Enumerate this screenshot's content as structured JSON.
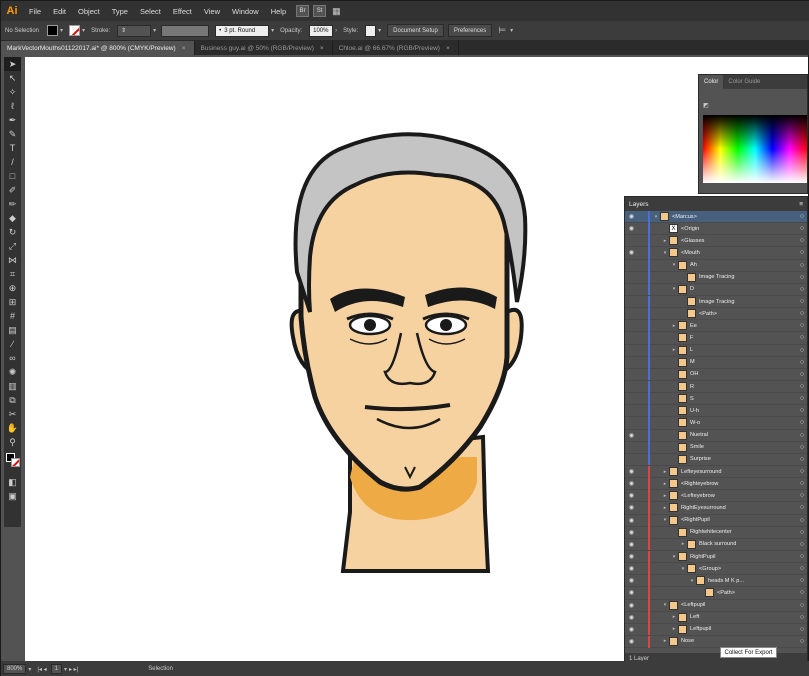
{
  "app": {
    "logo": "Ai"
  },
  "menu": [
    "File",
    "Edit",
    "Object",
    "Type",
    "Select",
    "Effect",
    "View",
    "Window",
    "Help"
  ],
  "menu_badges": [
    "Br",
    "St"
  ],
  "control": {
    "selection_label": "No Selection",
    "stroke_label": "Stroke:",
    "brush": "3 pt. Round",
    "opacity_label": "Opacity:",
    "opacity_value": "100%",
    "style_label": "Style:",
    "doc_setup": "Document Setup",
    "preferences": "Preferences"
  },
  "tabs": [
    {
      "label": "MarkVectorMouths01122017.ai* @ 800% (CMYK/Preview)"
    },
    {
      "label": "Business guy.ai @ 50% (RGB/Preview)"
    },
    {
      "label": "Chloe.ai @ 66.67% (RGB/Preview)"
    }
  ],
  "color_panel": {
    "tabs": [
      "Color",
      "Color Guide"
    ]
  },
  "layers_panel": {
    "title": "Layers",
    "footer": "1 Layer",
    "rows": [
      {
        "name": "<Marcus>",
        "indent": 0,
        "eye": true,
        "color": "#4a6fd8",
        "sel": true,
        "tw": "v"
      },
      {
        "name": "<Origin",
        "indent": 1,
        "eye": true,
        "color": "#4a6fd8",
        "tw": "",
        "thumb": "X"
      },
      {
        "name": "<Glasses",
        "indent": 1,
        "eye": false,
        "color": "#4a6fd8",
        "tw": ">"
      },
      {
        "name": "<Mouth",
        "indent": 1,
        "eye": true,
        "color": "#4a6fd8",
        "tw": "v"
      },
      {
        "name": "Ah",
        "indent": 2,
        "eye": false,
        "color": "#4a6fd8",
        "tw": "v"
      },
      {
        "name": "Image Tracing",
        "indent": 3,
        "eye": false,
        "color": "#4a6fd8",
        "tw": ""
      },
      {
        "name": "D",
        "indent": 2,
        "eye": false,
        "color": "#4a6fd8",
        "tw": "v"
      },
      {
        "name": "Image Tracing",
        "indent": 3,
        "eye": false,
        "color": "#4a6fd8",
        "tw": ""
      },
      {
        "name": "<Path>",
        "indent": 3,
        "eye": false,
        "color": "#4a6fd8",
        "tw": ""
      },
      {
        "name": "Ee",
        "indent": 2,
        "eye": false,
        "color": "#4a6fd8",
        "tw": ">"
      },
      {
        "name": "F",
        "indent": 2,
        "eye": false,
        "color": "#4a6fd8",
        "tw": ""
      },
      {
        "name": "L",
        "indent": 2,
        "eye": false,
        "color": "#4a6fd8",
        "tw": ">"
      },
      {
        "name": "M",
        "indent": 2,
        "eye": false,
        "color": "#4a6fd8",
        "tw": ""
      },
      {
        "name": "OH",
        "indent": 2,
        "eye": false,
        "color": "#4a6fd8",
        "tw": ""
      },
      {
        "name": "R",
        "indent": 2,
        "eye": false,
        "color": "#4a6fd8",
        "tw": ""
      },
      {
        "name": "S",
        "indent": 2,
        "eye": false,
        "color": "#4a6fd8",
        "tw": ""
      },
      {
        "name": "U-h",
        "indent": 2,
        "eye": false,
        "color": "#4a6fd8",
        "tw": ""
      },
      {
        "name": "W-o",
        "indent": 2,
        "eye": false,
        "color": "#4a6fd8",
        "tw": ""
      },
      {
        "name": "Nuetral",
        "indent": 2,
        "eye": true,
        "color": "#4a6fd8",
        "tw": ""
      },
      {
        "name": "Smile",
        "indent": 2,
        "eye": false,
        "color": "#4a6fd8",
        "tw": ""
      },
      {
        "name": "Surprise",
        "indent": 2,
        "eye": false,
        "color": "#4a6fd8",
        "tw": ""
      },
      {
        "name": "Lefteyesurround",
        "indent": 1,
        "eye": true,
        "color": "#d44",
        "tw": ">"
      },
      {
        "name": "<Righteyebrow",
        "indent": 1,
        "eye": true,
        "color": "#d44",
        "tw": ">"
      },
      {
        "name": "<Lefteyebrow",
        "indent": 1,
        "eye": true,
        "color": "#d44",
        "tw": ">"
      },
      {
        "name": "RightEyesurround",
        "indent": 1,
        "eye": true,
        "color": "#d44",
        "tw": ">"
      },
      {
        "name": "<RightPupil",
        "indent": 1,
        "eye": true,
        "color": "#d44",
        "tw": "v"
      },
      {
        "name": "Rightwhitecenter",
        "indent": 2,
        "eye": true,
        "color": "#d44",
        "tw": ""
      },
      {
        "name": "Black surround",
        "indent": 3,
        "eye": true,
        "color": "#d44",
        "tw": ">"
      },
      {
        "name": "RightPupil",
        "indent": 2,
        "eye": true,
        "color": "#d44",
        "tw": "v"
      },
      {
        "name": "<Group>",
        "indent": 3,
        "eye": true,
        "color": "#d44",
        "tw": "v"
      },
      {
        "name": "heads M K  p...",
        "indent": 4,
        "eye": true,
        "color": "#d44",
        "tw": "v"
      },
      {
        "name": "<Path>",
        "indent": 5,
        "eye": true,
        "color": "#d44",
        "tw": ""
      },
      {
        "name": "<Leftpupil",
        "indent": 1,
        "eye": true,
        "color": "#d44",
        "tw": "v"
      },
      {
        "name": "Left",
        "indent": 2,
        "eye": true,
        "color": "#d44",
        "tw": ">"
      },
      {
        "name": "Leftpupil",
        "indent": 2,
        "eye": true,
        "color": "#d44",
        "tw": ">"
      },
      {
        "name": "Nose",
        "indent": 1,
        "eye": true,
        "color": "#d44",
        "tw": ">"
      }
    ]
  },
  "status": {
    "zoom": "800%",
    "page": "1",
    "tool": "Selection"
  },
  "tooltip": "Collect For Export",
  "colors": {
    "skin": "#f6d2a0",
    "hair": "#c4c4c4",
    "shadow": "#eeaa44",
    "outline": "#1a1a1a"
  }
}
